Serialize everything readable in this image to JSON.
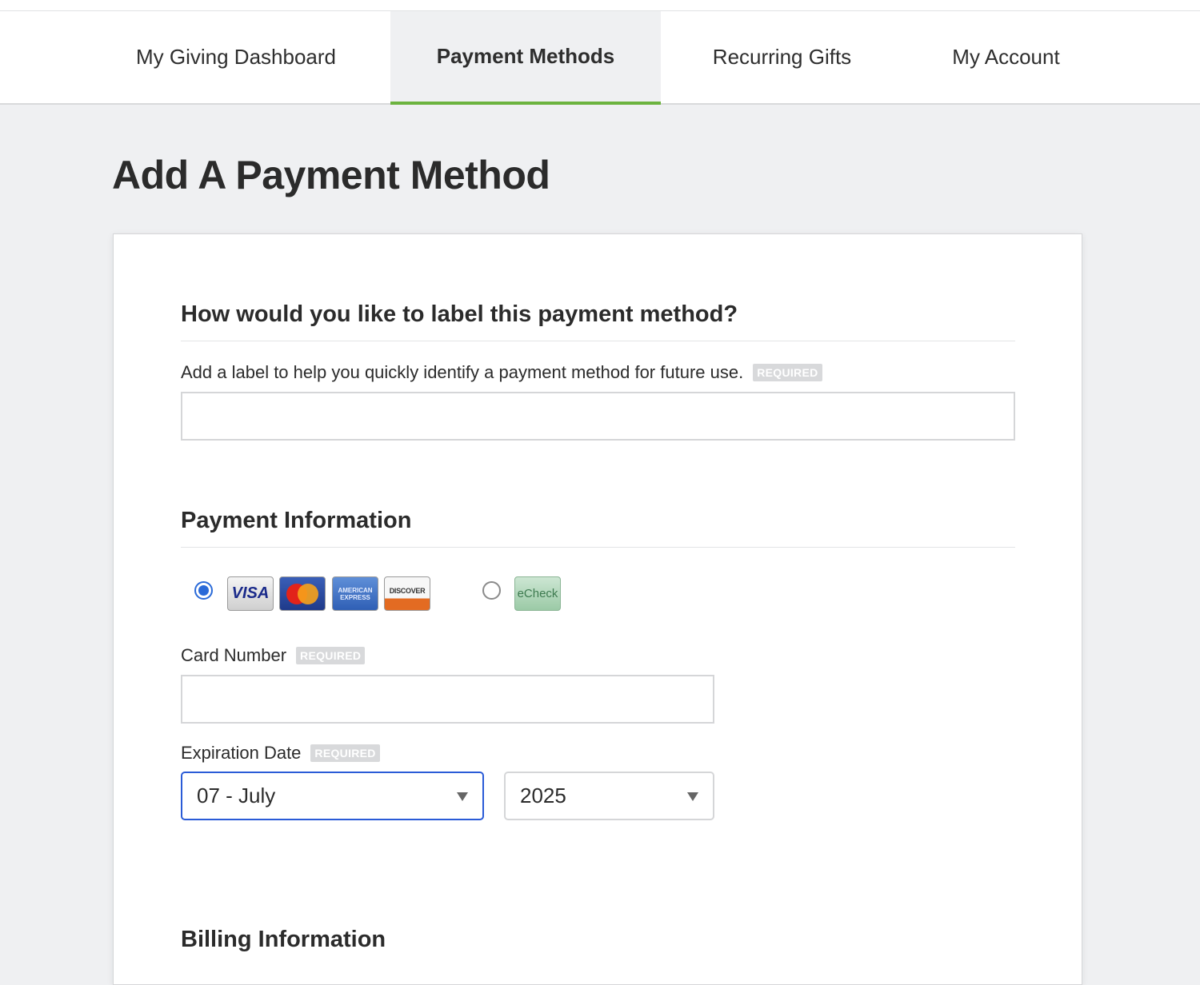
{
  "nav": {
    "tabs": [
      {
        "label": "My Giving Dashboard"
      },
      {
        "label": "Payment Methods"
      },
      {
        "label": "Recurring Gifts"
      },
      {
        "label": "My Account"
      }
    ]
  },
  "page": {
    "title": "Add A Payment Method"
  },
  "label_section": {
    "heading": "How would you like to label this payment method?",
    "field_label": "Add a label to help you quickly identify a payment method for future use.",
    "required": "REQUIRED",
    "value": ""
  },
  "payment_section": {
    "heading": "Payment Information",
    "cards": {
      "visa": "VISA",
      "amex_line1": "AMERICAN",
      "amex_line2": "EXPRESS",
      "discover": "DISCOVER",
      "echeck": "eCheck"
    },
    "card_number_label": "Card Number",
    "card_number_value": "",
    "expiration_label": "Expiration Date",
    "required": "REQUIRED",
    "month_value": "07 - July",
    "year_value": "2025"
  },
  "billing_section": {
    "heading": "Billing Information"
  },
  "colors": {
    "accent_green": "#6cb33f",
    "focus_blue": "#2a5bd7"
  }
}
